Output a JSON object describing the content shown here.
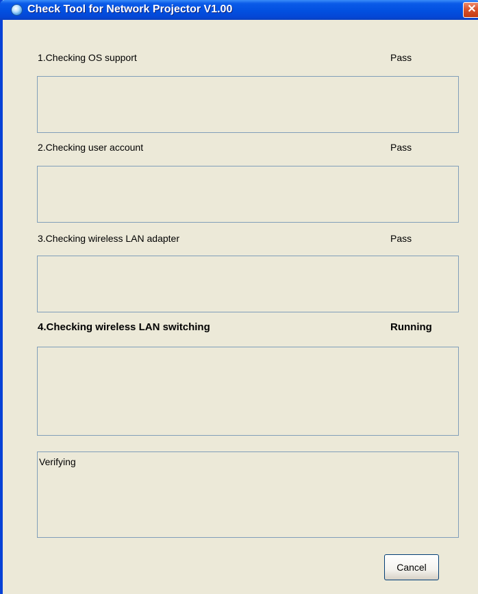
{
  "window": {
    "title": "Check Tool for Network Projector V1.00",
    "close_glyph": "✕"
  },
  "checks": [
    {
      "label": "1.Checking OS support",
      "status": "Pass",
      "result_text": ""
    },
    {
      "label": "2.Checking user account",
      "status": "Pass",
      "result_text": ""
    },
    {
      "label": "3.Checking wireless LAN adapter",
      "status": "Pass",
      "result_text": ""
    },
    {
      "label": "4.Checking wireless LAN switching",
      "status": "Running",
      "result_text": ""
    }
  ],
  "message_box": {
    "text": "Verifying"
  },
  "buttons": {
    "cancel": "Cancel"
  },
  "icons": {
    "app": "app-icon",
    "close": "close-icon"
  },
  "colors": {
    "titlebar": "#0250e0",
    "window_bg": "#ece9d8",
    "box_border": "#7f9db9",
    "close_button": "#d9542d"
  }
}
